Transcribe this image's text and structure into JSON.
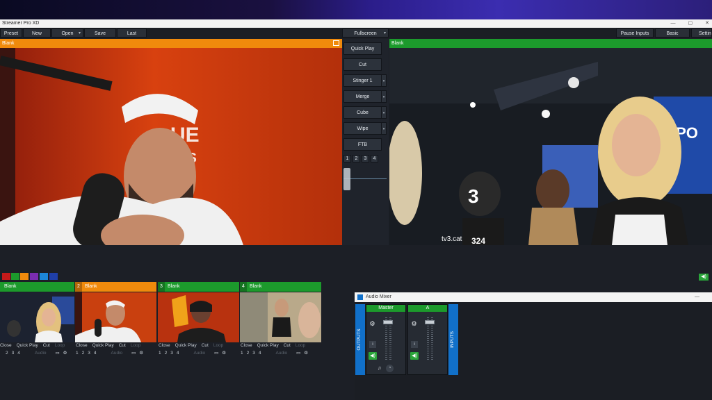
{
  "app": {
    "title": "Streamer Pro XD",
    "window_buttons": [
      "—",
      "▢",
      "✕"
    ]
  },
  "toolbar": {
    "preset": "Preset",
    "new": "New",
    "open": "Open",
    "save": "Save",
    "last": "Last",
    "fullscreen": "Fullscreen",
    "pause_inputs": "Pause Inputs",
    "basic": "Basic",
    "settings": "Settin"
  },
  "preview": {
    "label": "Blank"
  },
  "output": {
    "label": "Blank"
  },
  "transitions": {
    "quick_play": "Quick Play",
    "cut": "Cut",
    "stinger": "Stinger 1",
    "merge": "Merge",
    "cube": "Cube",
    "wipe": "Wipe",
    "ftb": "FTB",
    "numbers": [
      "1",
      "2",
      "3",
      "4"
    ]
  },
  "swatches": [
    "#c41a1a",
    "#1c9a2c",
    "#f08a0c",
    "#7b2db0",
    "#1c86d8",
    "#1f3fa8"
  ],
  "inputs": [
    {
      "number": "",
      "label": "Blank",
      "color": "#1c9a2c",
      "ctrls": [
        "Close",
        "Quick Play",
        "Cut",
        "Loop"
      ],
      "nums": [
        "2",
        "3",
        "4"
      ],
      "audio": "Audio"
    },
    {
      "number": "2",
      "label": "Blank",
      "color": "#f08a0c",
      "ctrls": [
        "Close",
        "Quick Play",
        "Cut",
        "Loop"
      ],
      "nums": [
        "1",
        "2",
        "3",
        "4"
      ],
      "audio": "Audio"
    },
    {
      "number": "3",
      "label": "Blank",
      "color": "#1c9a2c",
      "ctrls": [
        "Close",
        "Quick Play",
        "Cut",
        "Loop"
      ],
      "nums": [
        "1",
        "2",
        "3",
        "4"
      ],
      "audio": "Audio"
    },
    {
      "number": "4",
      "label": "Blank",
      "color": "#1c9a2c",
      "ctrls": [
        "Close",
        "Quick Play",
        "Cut",
        "Loop"
      ],
      "nums": [
        "1",
        "2",
        "3",
        "4"
      ],
      "audio": "Audio"
    }
  ],
  "mixer": {
    "title": "Audio Mixer",
    "outputs_label": "OUTPUTS",
    "inputs_label": "INPUTS",
    "channels": [
      {
        "name": "Master"
      },
      {
        "name": "A"
      }
    ]
  },
  "colors": {
    "preview_bar": "#f08a0c",
    "output_bar": "#1c9a2c",
    "accent_blue": "#1170c9"
  }
}
